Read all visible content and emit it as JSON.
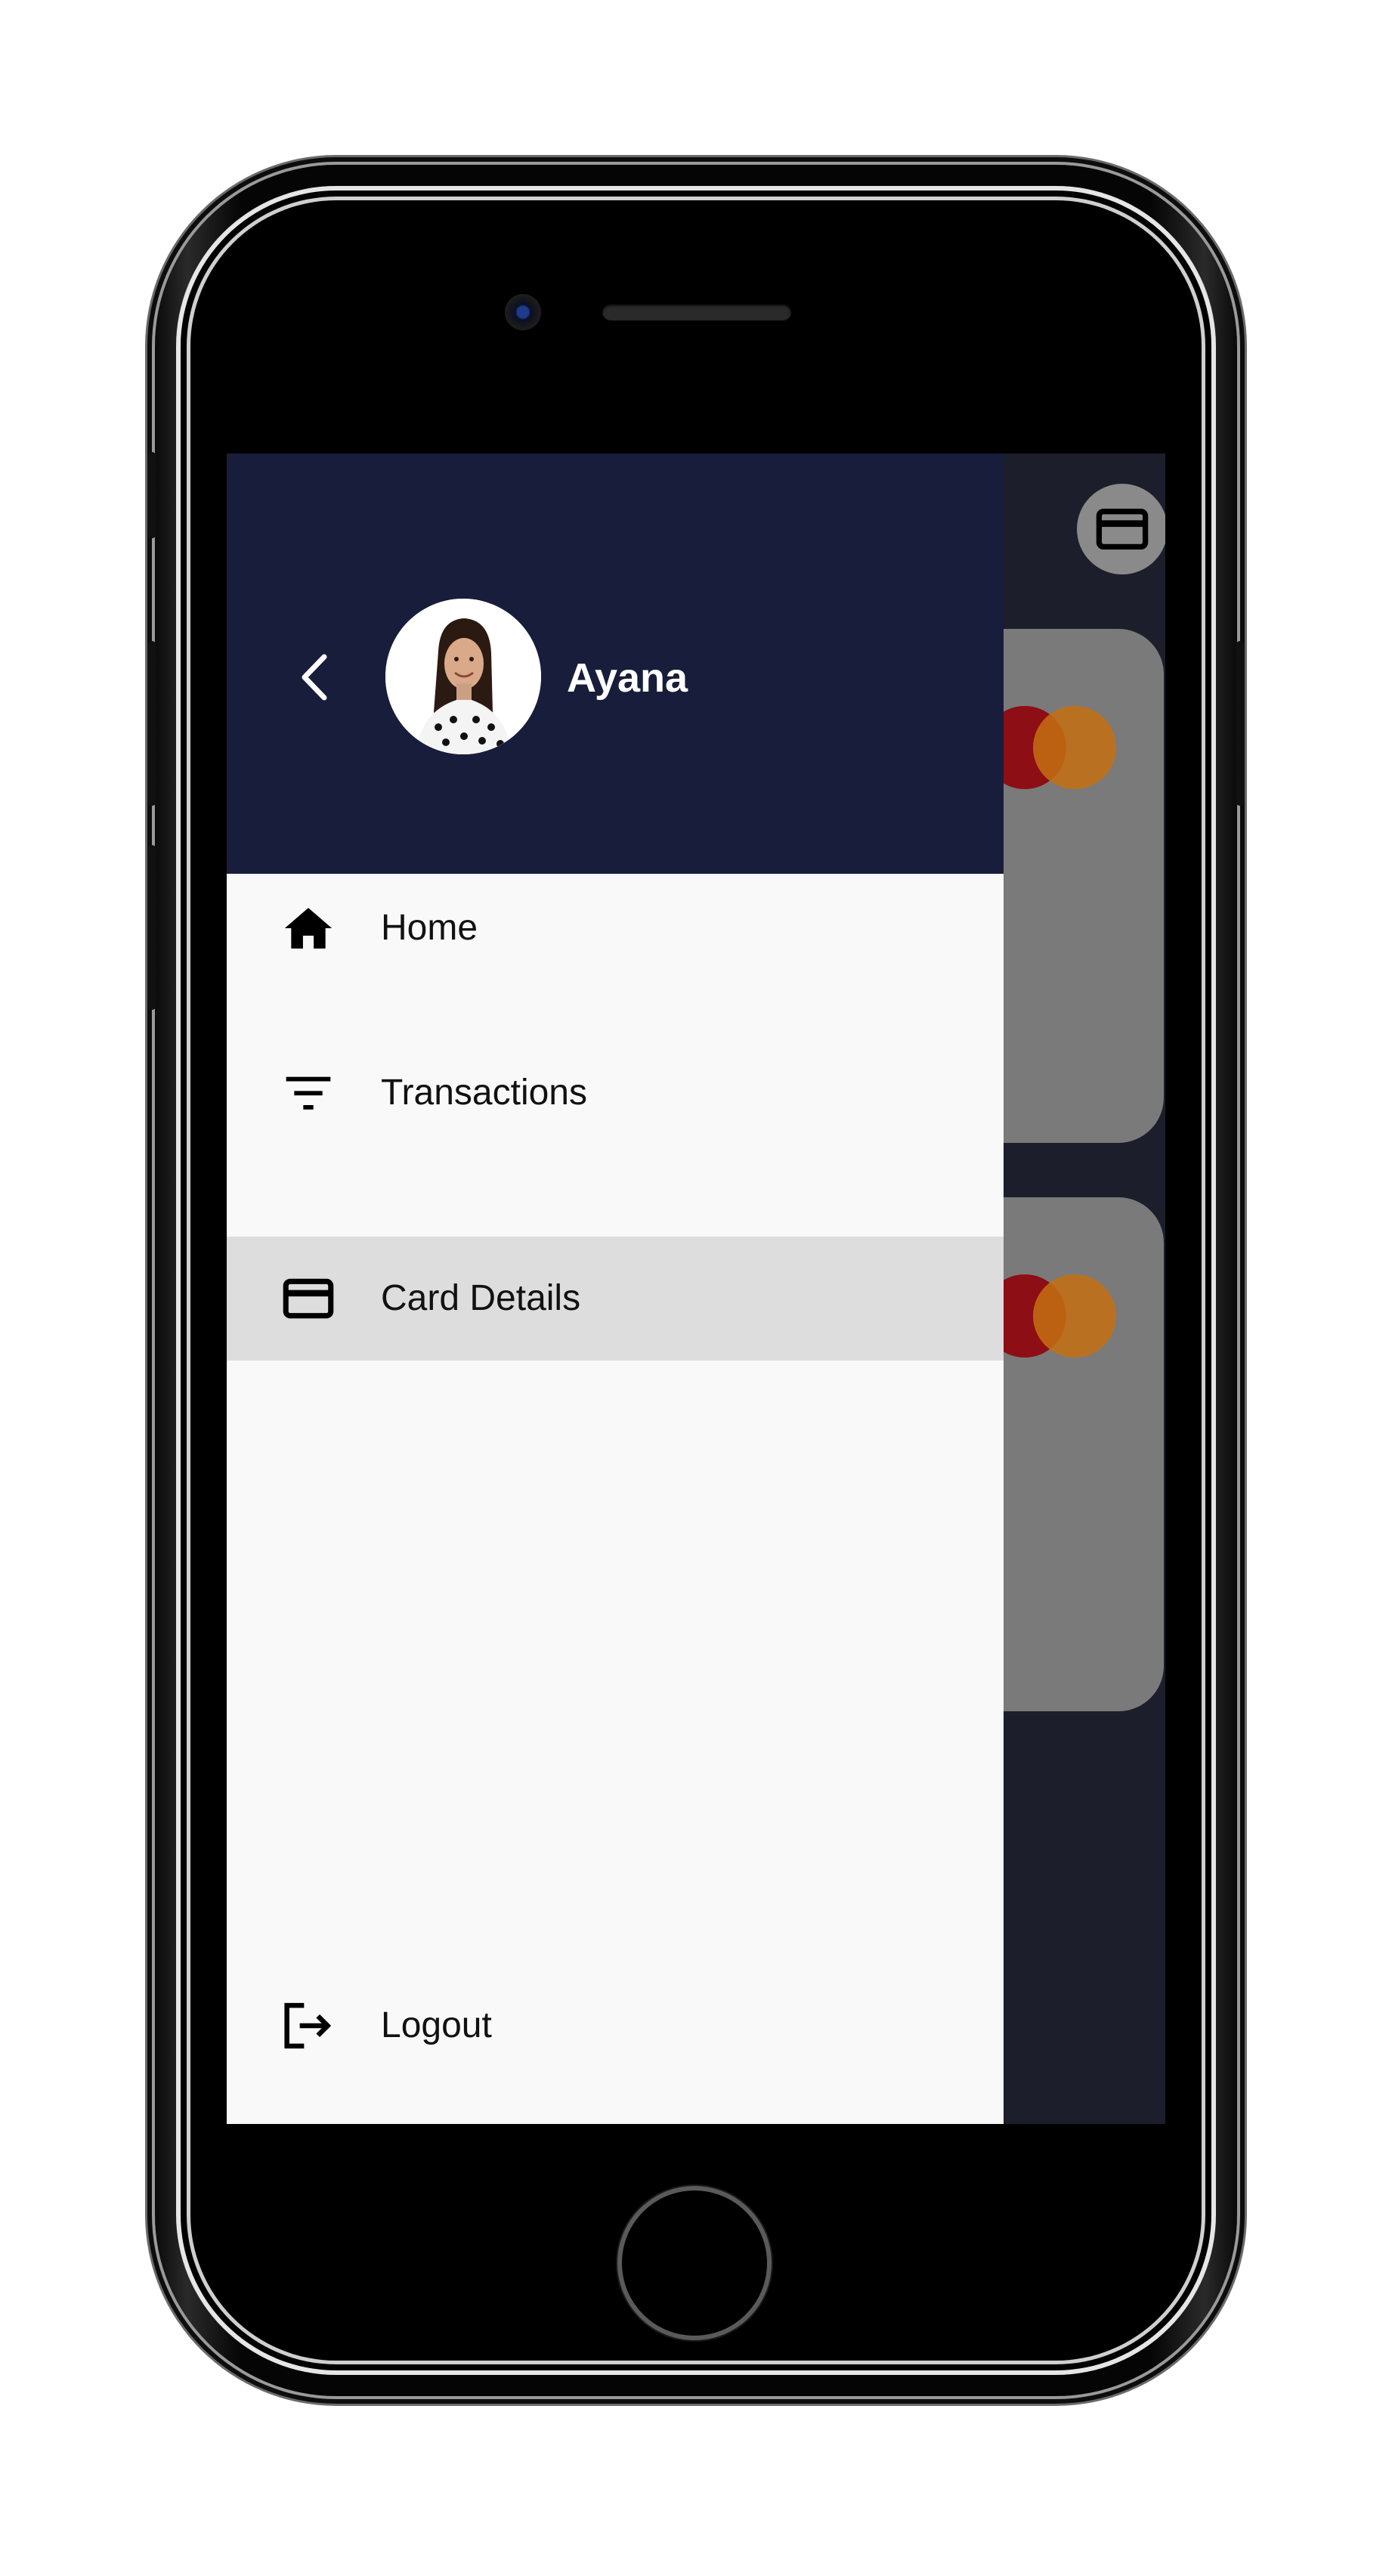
{
  "user": {
    "name": "Ayana"
  },
  "drawer": {
    "items": [
      {
        "label": "Home",
        "icon": "home-icon"
      },
      {
        "label": "Transactions",
        "icon": "filter-icon"
      },
      {
        "label": "Card Details",
        "icon": "credit-card-icon",
        "selected": true
      }
    ],
    "logout": {
      "label": "Logout",
      "icon": "logout-icon"
    }
  },
  "colors": {
    "header": "#181d3b",
    "drawer_bg": "#f9f9f9",
    "selected_bg": "#dddddd",
    "mastercard_red": "#8d0e14",
    "mastercard_orange": "#c47012"
  }
}
